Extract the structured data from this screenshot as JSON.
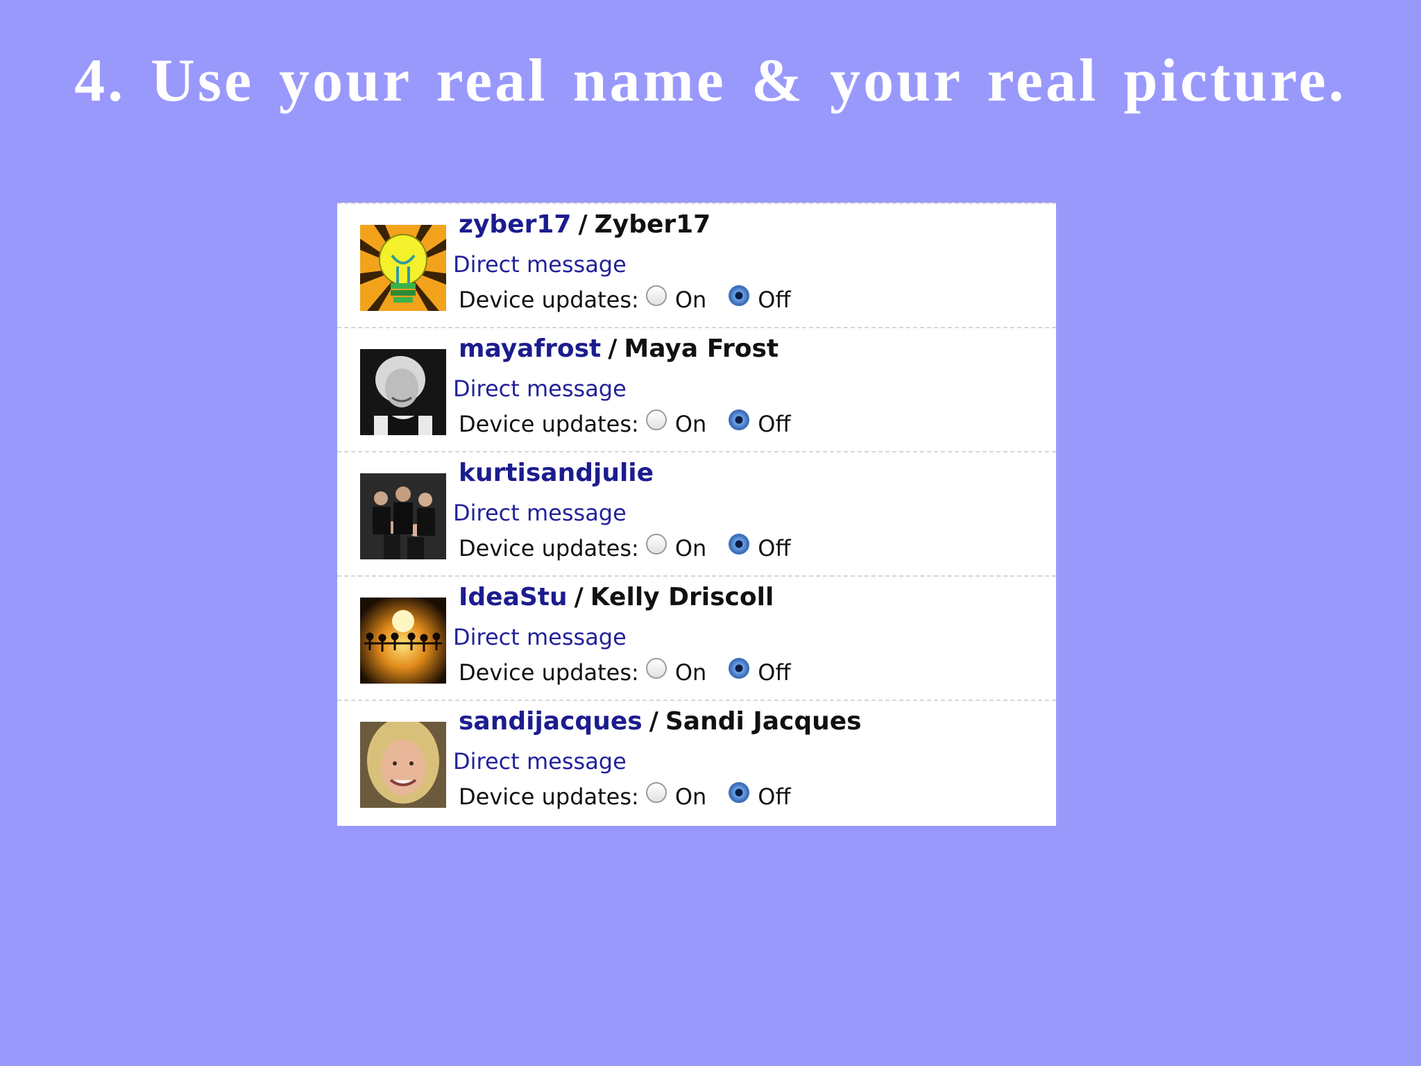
{
  "slide": {
    "title": "4. Use your real name & your real picture."
  },
  "following": [
    {
      "username": "zyber17",
      "separator": "/",
      "full_name": "Zyber17",
      "avatar_icon": "lightbulb-icon",
      "direct_message": "Direct message",
      "device_updates_label": "Device updates:",
      "on_label": "On",
      "off_label": "Off",
      "device_updates": "Off"
    },
    {
      "username": "mayafrost",
      "separator": "/",
      "full_name": "Maya Frost",
      "avatar_icon": "portrait-photo",
      "direct_message": "Direct message",
      "device_updates_label": "Device updates:",
      "on_label": "On",
      "off_label": "Off",
      "device_updates": "Off"
    },
    {
      "username": "kurtisandjulie",
      "separator": "",
      "full_name": "",
      "avatar_icon": "family-photo",
      "direct_message": "Direct message",
      "device_updates_label": "Device updates:",
      "on_label": "On",
      "off_label": "Off",
      "device_updates": "Off"
    },
    {
      "username": "IdeaStu",
      "separator": "/",
      "full_name": "Kelly Driscoll",
      "avatar_icon": "people-silhouette-icon",
      "direct_message": "Direct message",
      "device_updates_label": "Device updates:",
      "on_label": "On",
      "off_label": "Off",
      "device_updates": "Off"
    },
    {
      "username": "sandijacques",
      "separator": "/",
      "full_name": "Sandi Jacques",
      "avatar_icon": "portrait-photo",
      "direct_message": "Direct message",
      "device_updates_label": "Device updates:",
      "on_label": "On",
      "off_label": "Off",
      "device_updates": "Off"
    }
  ],
  "colors": {
    "background": "#9999fc",
    "username": "#1c1c8f",
    "link": "#222299"
  }
}
